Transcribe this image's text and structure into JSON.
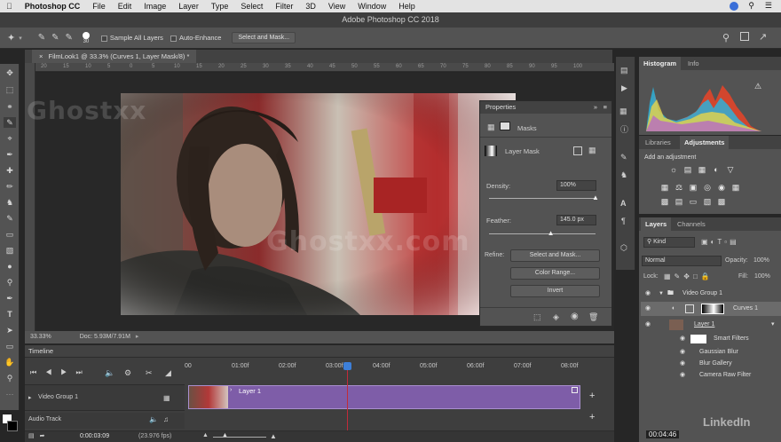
{
  "menubar": {
    "app_name": "Photoshop CC",
    "items": [
      "File",
      "Edit",
      "Image",
      "Layer",
      "Type",
      "Select",
      "Filter",
      "3D",
      "View",
      "Window",
      "Help"
    ]
  },
  "window_title": "Adobe Photoshop CC 2018",
  "options_bar": {
    "brush_size": "30",
    "sample_all_layers": "Sample All Layers",
    "auto_enhance": "Auto-Enhance",
    "select_and_mask": "Select and Mask..."
  },
  "document_tab": "FilmLook1 @ 33.3% (Curves 1, Layer Mask/8) *",
  "ruler_ticks": [
    "20",
    "15",
    "10",
    "5",
    "0",
    "5",
    "10",
    "15",
    "20",
    "25",
    "30",
    "35",
    "40",
    "45",
    "50",
    "55",
    "60",
    "65",
    "70",
    "75",
    "80",
    "85",
    "90",
    "95",
    "100"
  ],
  "status": {
    "zoom": "33.33%",
    "doc": "Doc: 5.93M/7.91M"
  },
  "properties": {
    "title": "Properties",
    "masks_label": "Masks",
    "layer_mask_label": "Layer Mask",
    "density_label": "Density:",
    "density_value": "100%",
    "density_fraction": 1.0,
    "feather_label": "Feather:",
    "feather_value": "145.0 px",
    "feather_fraction": 0.58,
    "refine_label": "Refine:",
    "select_and_mask": "Select and Mask...",
    "color_range": "Color Range...",
    "invert": "Invert"
  },
  "histogram": {
    "tab_active": "Histogram",
    "tab_other": "Info"
  },
  "adjustments": {
    "tab_other": "Libraries",
    "tab_active": "Adjustments",
    "add_label": "Add an adjustment"
  },
  "layers": {
    "tab_active": "Layers",
    "tab_other": "Channels",
    "kind": "Kind",
    "blend_mode": "Normal",
    "opacity_label": "Opacity:",
    "opacity_value": "100%",
    "lock_label": "Lock:",
    "fill_label": "Fill:",
    "fill_value": "100%",
    "rows": [
      {
        "name": "Video Group 1"
      },
      {
        "name": "Curves 1"
      },
      {
        "name": "Layer 1"
      },
      {
        "name": "Smart Filters"
      },
      {
        "name": "Gaussian Blur"
      },
      {
        "name": "Blur Gallery"
      },
      {
        "name": "Camera Raw Filter"
      }
    ]
  },
  "timeline": {
    "title": "Timeline",
    "ticks": [
      "00",
      "01:00f",
      "02:00f",
      "03:00f",
      "04:00f",
      "05:00f",
      "06:00f",
      "07:00f",
      "08:00f"
    ],
    "video_group": "Video Group 1",
    "layer_clip": "Layer 1",
    "audio_track": "Audio Track",
    "timecode": "0:00:03:09",
    "fps": "(23.976 fps)"
  },
  "watermarks": {
    "brand": "Ghostxx.com",
    "side": "Ghostxx",
    "corner": "LinkedIn",
    "time": "00:04:46"
  },
  "colors": {
    "accent_purple": "#7e5da8",
    "playhead": "#c02b3a",
    "panel": "#535353",
    "dark": "#3e3e3e"
  }
}
